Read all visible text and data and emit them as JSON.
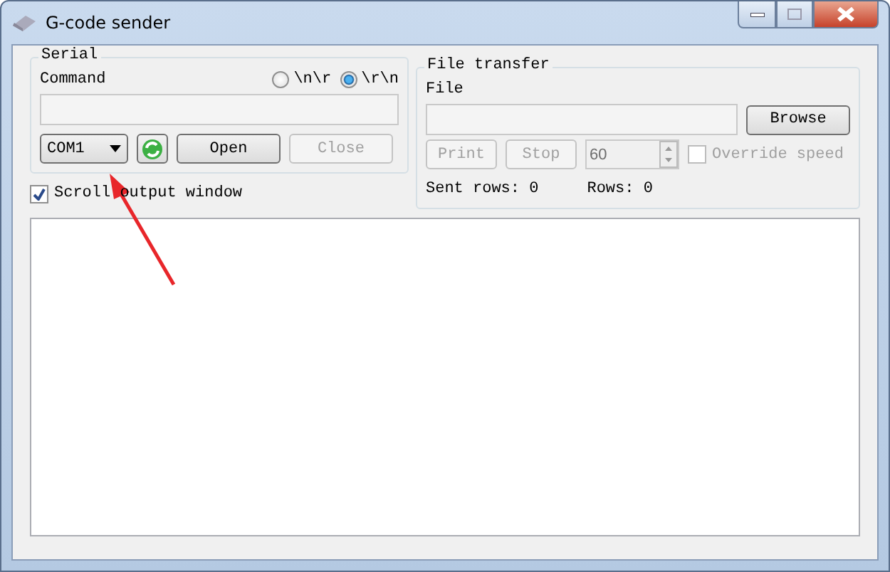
{
  "window": {
    "title": "G-code sender"
  },
  "serial": {
    "title": "Serial",
    "command_label": "Command",
    "line_endings": [
      {
        "label": "\\n\\r",
        "selected": false
      },
      {
        "label": "\\r\\n",
        "selected": true
      }
    ],
    "port": "COM1",
    "buttons": [
      {
        "label": "Open",
        "disabled": false
      },
      {
        "label": "Close",
        "disabled": true
      }
    ]
  },
  "scroll_output": {
    "label": "Scroll output window",
    "checked": true
  },
  "file_transfer": {
    "title": "File transfer",
    "file_label": "File",
    "browse": {
      "label": "Browse",
      "disabled": false
    },
    "buttons": [
      {
        "label": "Print",
        "disabled": true
      },
      {
        "label": "Stop",
        "disabled": true
      }
    ],
    "speed": {
      "value": "60",
      "disabled": true
    },
    "override": {
      "label": "Override speed",
      "checked": false,
      "disabled": true
    },
    "sent_rows": "Sent rows: 0",
    "rows": "Rows: 0"
  }
}
